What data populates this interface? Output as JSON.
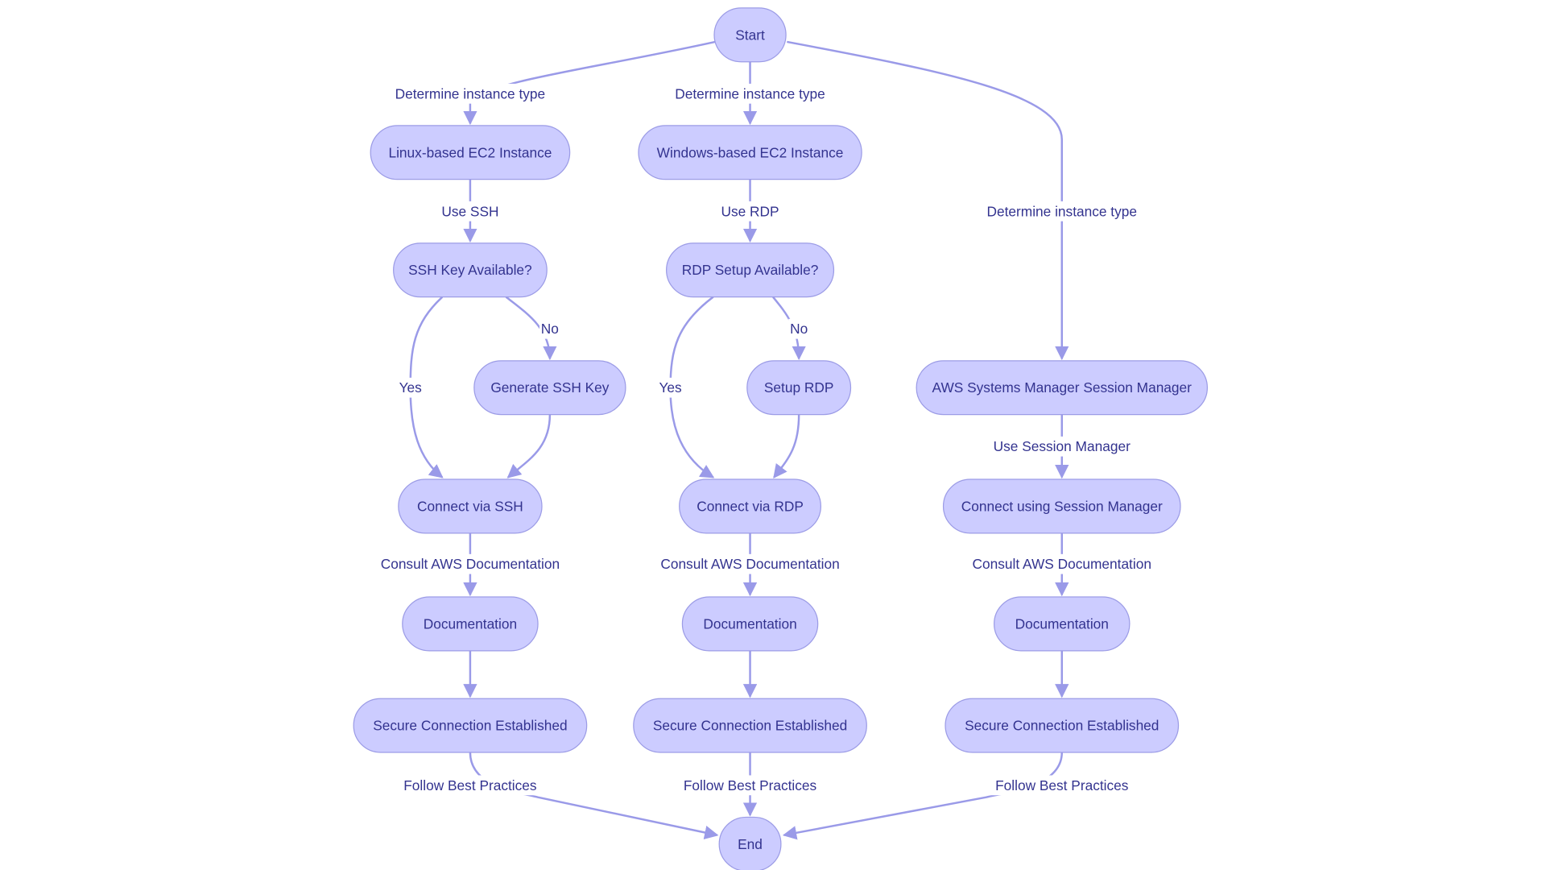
{
  "colors": {
    "node_fill": "#ccccff",
    "node_stroke": "#9c9ce6",
    "edge": "#9a9ae8",
    "text": "#33338f"
  },
  "nodes": {
    "start": "Start",
    "linux": "Linux-based EC2 Instance",
    "windows": "Windows-based EC2 Instance",
    "ssh_q": "SSH Key Available?",
    "rdp_q": "RDP Setup Available?",
    "gen_ssh": "Generate SSH Key",
    "setup_rdp": "Setup RDP",
    "ssm": "AWS Systems Manager Session Manager",
    "conn_ssh": "Connect via SSH",
    "conn_rdp": "Connect via RDP",
    "conn_ssm": "Connect using Session Manager",
    "doc1": "Documentation",
    "doc2": "Documentation",
    "doc3": "Documentation",
    "sec1": "Secure Connection Established",
    "sec2": "Secure Connection Established",
    "sec3": "Secure Connection Established",
    "end": "End"
  },
  "edges": {
    "start_linux": "Determine instance type",
    "start_windows": "Determine instance type",
    "start_ssm": "Determine instance type",
    "linux_ssh": "Use SSH",
    "windows_rdp": "Use RDP",
    "ssh_no": "No",
    "ssh_yes": "Yes",
    "rdp_no": "No",
    "rdp_yes": "Yes",
    "ssm_use": "Use Session Manager",
    "ssh_doc": "Consult AWS Documentation",
    "rdp_doc": "Consult AWS Documentation",
    "ssm_doc": "Consult AWS Documentation",
    "sec1_end": "Follow Best Practices",
    "sec2_end": "Follow Best Practices",
    "sec3_end": "Follow Best Practices"
  }
}
